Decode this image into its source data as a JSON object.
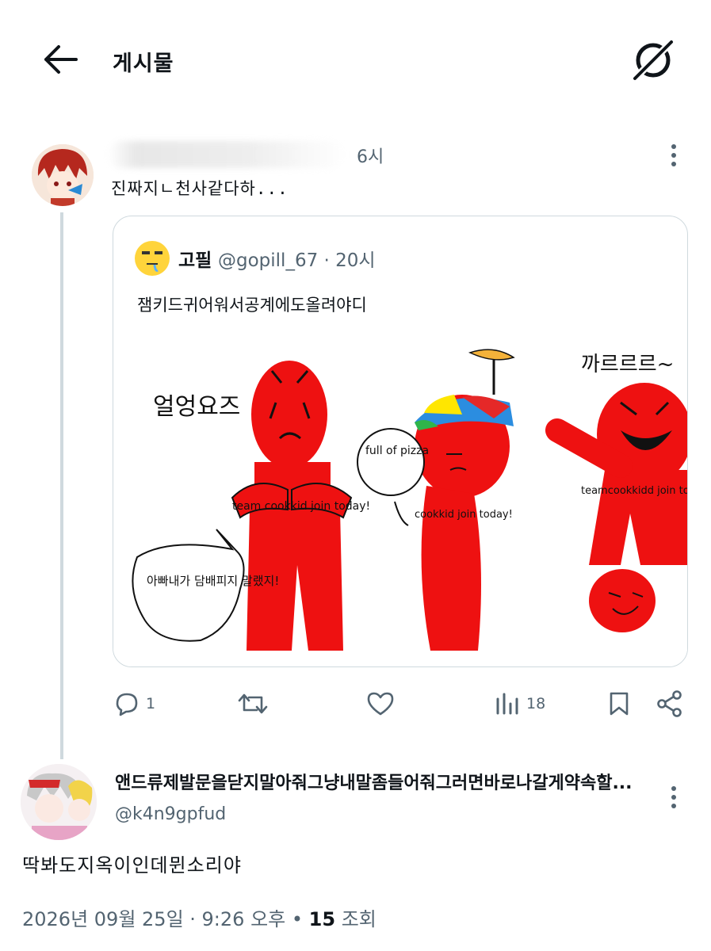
{
  "header": {
    "title": "게시물",
    "back_icon": "arrow-left-icon",
    "grok_icon": "grok-icon"
  },
  "parent_tweet": {
    "time": "6시",
    "text": "진짜지ㄴ천사같다하...",
    "quote": {
      "name": "고필",
      "handle_time": "@gopill_67 · 20시",
      "text": "잼키드귀어워서공계에도올려야디",
      "image_texts": {
        "t1": "얼엉요즈",
        "t2": "team cookkid join today!",
        "t3": "full of pizza",
        "t4": "cookkid join today!",
        "t5": "아빠내가 담배피지 말랬지!",
        "t6": "까르르르~",
        "t7": "teamcookkidd join today"
      }
    },
    "actions": {
      "reply_count": "1",
      "views_count": "18"
    }
  },
  "main_tweet": {
    "name": "앤드류제발문을닫지말아줘그냥내말좀들어줘그러면바로나갈게약속할...",
    "handle": "@k4n9gpfud",
    "text": "딱봐도지옥이인데뮌소리야",
    "date": "2026년 09월 25일 · 9:26 오후",
    "dot": " • ",
    "views": "15",
    "views_label": " 조회"
  },
  "colors": {
    "text": "#0f1419",
    "secondary": "#536471",
    "border": "#cfd9de",
    "red": "#ee1111"
  }
}
